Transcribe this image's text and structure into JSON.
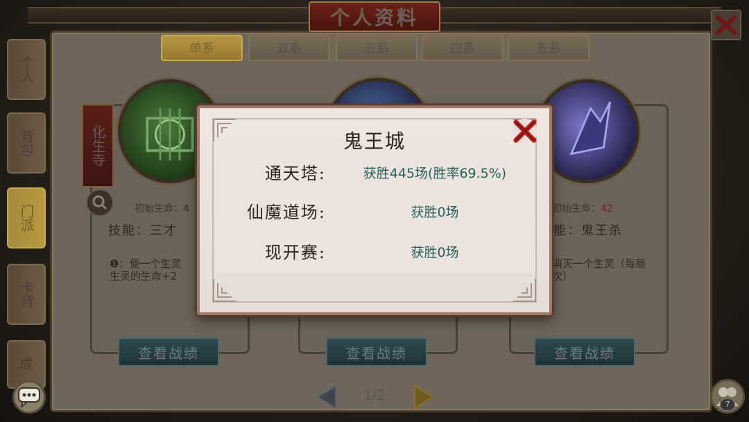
{
  "header": {
    "title": "个人资料"
  },
  "mode_tabs": [
    {
      "label": "单系",
      "active": true
    },
    {
      "label": "双系",
      "active": false
    },
    {
      "label": "三系",
      "active": false
    },
    {
      "label": "四系",
      "active": false
    },
    {
      "label": "五系",
      "active": false
    }
  ],
  "side_tabs": [
    {
      "label": "个人",
      "active": false
    },
    {
      "label": "背包",
      "active": false
    },
    {
      "label": "门派",
      "active": true
    },
    {
      "label": "卡背",
      "active": false
    },
    {
      "label": "成",
      "active": false
    }
  ],
  "cards": {
    "left": {
      "banner": "化生寺",
      "initial_life_label": "初始生命：4",
      "skill": "技能：三才",
      "desc_1": "❶：使一个生灵",
      "desc_2": "生灵的生命+2",
      "record_button": "查看战绩"
    },
    "middle": {
      "record_button": "查看战绩"
    },
    "right": {
      "initial_life_label": "初始生命：",
      "initial_life_value": "42",
      "skill": "能：鬼王杀",
      "desc_1": "消灭一个生灵（每局",
      "desc_2": "次）",
      "record_button": "查看战绩"
    }
  },
  "pager": {
    "text": "1/2"
  },
  "friends": {
    "badge": "7"
  },
  "modal": {
    "title": "鬼王城",
    "rows": [
      {
        "label": "通天塔:",
        "value": "获胜445场(胜率69.5%)"
      },
      {
        "label": "仙魔道场:",
        "value": "获胜0场"
      },
      {
        "label": "现开赛:",
        "value": "获胜0场"
      }
    ]
  },
  "colors": {
    "accent_gold": "#b89545",
    "value_teal": "#23615a",
    "close_red": "#b0201a"
  },
  "icons": {
    "top_close": "close-x-icon",
    "modal_close": "close-x-icon",
    "search": "search-icon",
    "chat": "chat-bubble-icon",
    "friends": "friends-icon",
    "prev": "arrow-left-icon",
    "next": "arrow-right-icon"
  }
}
